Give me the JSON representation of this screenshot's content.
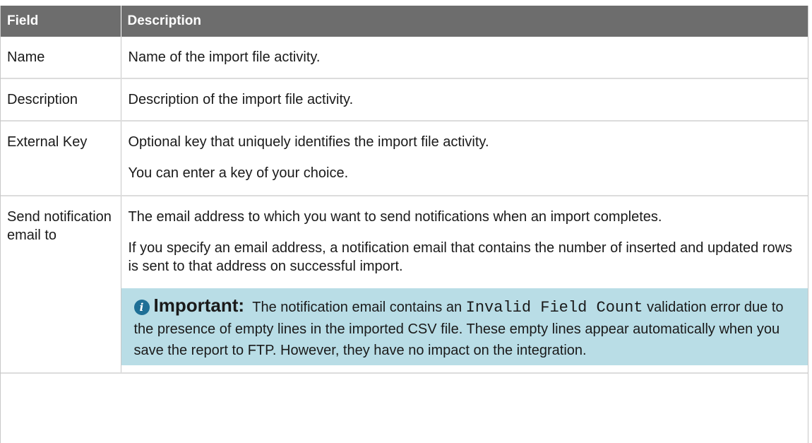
{
  "table": {
    "headers": [
      "Field",
      "Description"
    ],
    "rows": [
      {
        "field": "Name",
        "paragraphs": [
          "Name of the import file activity."
        ]
      },
      {
        "field": "Description",
        "paragraphs": [
          "Description of the import file activity."
        ]
      },
      {
        "field": "External Key",
        "paragraphs": [
          "Optional key that uniquely identifies the import file activity.",
          "You can enter a key of your choice."
        ]
      },
      {
        "field": "Send notification email to",
        "paragraphs": [
          "The email address to which you want to send notifications when an import completes.",
          "If you specify an email address, a notification email that contains the number of inserted and updated rows is sent to that address on successful import."
        ],
        "note": {
          "icon": "info-icon",
          "label": "Important:",
          "text_before": "The notification email contains an",
          "code": "Invalid Field Count",
          "text_after": "validation error due to the presence of empty lines in the imported CSV file. These empty lines appear automatically when you save the report to FTP. However, they have no impact on the integration."
        }
      }
    ]
  },
  "colors": {
    "header_bg": "#6d6d6d",
    "note_bg": "#b9dde6",
    "info_icon": "#1f6f96"
  }
}
